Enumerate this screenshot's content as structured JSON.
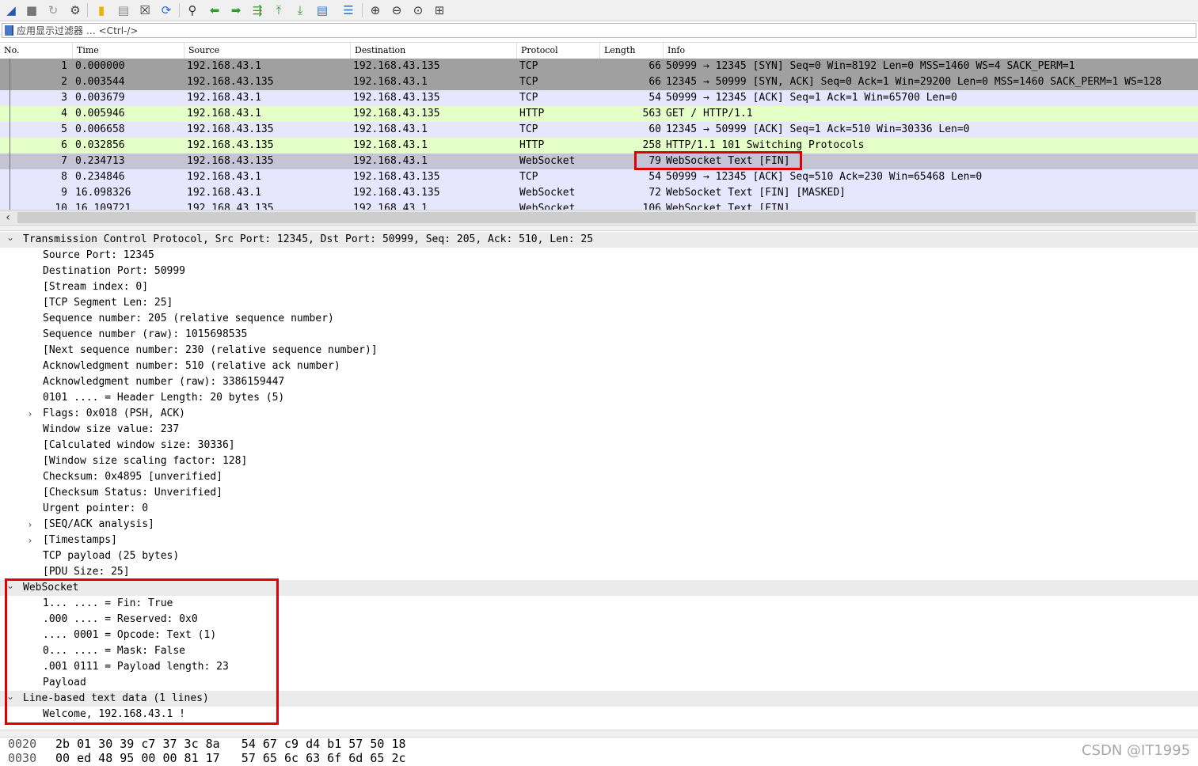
{
  "filter": {
    "placeholder": "应用显示过滤器 … <Ctrl-/>"
  },
  "columns": [
    "No.",
    "Time",
    "Source",
    "Destination",
    "Protocol",
    "Length",
    "Info"
  ],
  "colors": {
    "tcp_row": "#e7e6ff",
    "http_row": "#e4ffc7",
    "syn_row": "#a0a0a0",
    "selected_row": "#c4c4d6",
    "highlight_box": "#e00000"
  },
  "packets": [
    {
      "no": "1",
      "time": "0.000000",
      "src": "192.168.43.1",
      "dst": "192.168.43.135",
      "proto": "TCP",
      "len": "66",
      "info": "50999 → 12345 [SYN] Seq=0 Win=8192 Len=0 MSS=1460 WS=4 SACK_PERM=1",
      "style": "syn"
    },
    {
      "no": "2",
      "time": "0.003544",
      "src": "192.168.43.135",
      "dst": "192.168.43.1",
      "proto": "TCP",
      "len": "66",
      "info": "12345 → 50999 [SYN, ACK] Seq=0 Ack=1 Win=29200 Len=0 MSS=1460 SACK_PERM=1 WS=128",
      "style": "syn"
    },
    {
      "no": "3",
      "time": "0.003679",
      "src": "192.168.43.1",
      "dst": "192.168.43.135",
      "proto": "TCP",
      "len": "54",
      "info": "50999 → 12345 [ACK] Seq=1 Ack=1 Win=65700 Len=0",
      "style": "tcp"
    },
    {
      "no": "4",
      "time": "0.005946",
      "src": "192.168.43.1",
      "dst": "192.168.43.135",
      "proto": "HTTP",
      "len": "563",
      "info": "GET / HTTP/1.1",
      "style": "http"
    },
    {
      "no": "5",
      "time": "0.006658",
      "src": "192.168.43.135",
      "dst": "192.168.43.1",
      "proto": "TCP",
      "len": "60",
      "info": "12345 → 50999 [ACK] Seq=1 Ack=510 Win=30336 Len=0",
      "style": "tcp"
    },
    {
      "no": "6",
      "time": "0.032856",
      "src": "192.168.43.135",
      "dst": "192.168.43.1",
      "proto": "HTTP",
      "len": "258",
      "info": "HTTP/1.1 101 Switching Protocols",
      "style": "http"
    },
    {
      "no": "7",
      "time": "0.234713",
      "src": "192.168.43.135",
      "dst": "192.168.43.1",
      "proto": "WebSocket",
      "len": "79",
      "info": "WebSocket Text [FIN]",
      "style": "selected"
    },
    {
      "no": "8",
      "time": "0.234846",
      "src": "192.168.43.1",
      "dst": "192.168.43.135",
      "proto": "TCP",
      "len": "54",
      "info": "50999 → 12345 [ACK] Seq=510 Ack=230 Win=65468 Len=0",
      "style": "tcp"
    },
    {
      "no": "9",
      "time": "16.098326",
      "src": "192.168.43.1",
      "dst": "192.168.43.135",
      "proto": "WebSocket",
      "len": "72",
      "info": "WebSocket Text [FIN] [MASKED]",
      "style": "tcp"
    },
    {
      "no": "10",
      "time": "16.109721",
      "src": "192.168.43.135",
      "dst": "192.168.43.1",
      "proto": "WebSocket",
      "len": "106",
      "info": "WebSocket Text [FIN]",
      "style": "tcp"
    }
  ],
  "details": [
    {
      "text": "Transmission Control Protocol, Src Port: 12345, Dst Port: 50999, Seq: 205, Ack: 510, Len: 25",
      "level": 0,
      "arrow": "expanded",
      "section": true
    },
    {
      "text": "Source Port: 12345",
      "level": 1,
      "arrow": "none"
    },
    {
      "text": "Destination Port: 50999",
      "level": 1,
      "arrow": "none"
    },
    {
      "text": "[Stream index: 0]",
      "level": 1,
      "arrow": "none"
    },
    {
      "text": "[TCP Segment Len: 25]",
      "level": 1,
      "arrow": "none"
    },
    {
      "text": "Sequence number: 205    (relative sequence number)",
      "level": 1,
      "arrow": "none"
    },
    {
      "text": "Sequence number (raw): 1015698535",
      "level": 1,
      "arrow": "none"
    },
    {
      "text": "[Next sequence number: 230    (relative sequence number)]",
      "level": 1,
      "arrow": "none"
    },
    {
      "text": "Acknowledgment number: 510    (relative ack number)",
      "level": 1,
      "arrow": "none"
    },
    {
      "text": "Acknowledgment number (raw): 3386159447",
      "level": 1,
      "arrow": "none"
    },
    {
      "text": "0101 .... = Header Length: 20 bytes (5)",
      "level": 1,
      "arrow": "none"
    },
    {
      "text": "Flags: 0x018 (PSH, ACK)",
      "level": 1,
      "arrow": "collapsed"
    },
    {
      "text": "Window size value: 237",
      "level": 1,
      "arrow": "none"
    },
    {
      "text": "[Calculated window size: 30336]",
      "level": 1,
      "arrow": "none"
    },
    {
      "text": "[Window size scaling factor: 128]",
      "level": 1,
      "arrow": "none"
    },
    {
      "text": "Checksum: 0x4895 [unverified]",
      "level": 1,
      "arrow": "none"
    },
    {
      "text": "[Checksum Status: Unverified]",
      "level": 1,
      "arrow": "none"
    },
    {
      "text": "Urgent pointer: 0",
      "level": 1,
      "arrow": "none"
    },
    {
      "text": "[SEQ/ACK analysis]",
      "level": 1,
      "arrow": "collapsed"
    },
    {
      "text": "[Timestamps]",
      "level": 1,
      "arrow": "collapsed"
    },
    {
      "text": "TCP payload (25 bytes)",
      "level": 1,
      "arrow": "none"
    },
    {
      "text": "[PDU Size: 25]",
      "level": 1,
      "arrow": "none"
    },
    {
      "text": "WebSocket",
      "level": 0,
      "arrow": "expanded",
      "section": true
    },
    {
      "text": "1... .... = Fin: True",
      "level": 1,
      "arrow": "none"
    },
    {
      "text": ".000 .... = Reserved: 0x0",
      "level": 1,
      "arrow": "none"
    },
    {
      "text": ".... 0001 = Opcode: Text (1)",
      "level": 1,
      "arrow": "none"
    },
    {
      "text": "0... .... = Mask: False",
      "level": 1,
      "arrow": "none"
    },
    {
      "text": ".001 0111 = Payload length: 23",
      "level": 1,
      "arrow": "none"
    },
    {
      "text": "Payload",
      "level": 1,
      "arrow": "none"
    },
    {
      "text": "Line-based text data (1 lines)",
      "level": 0,
      "arrow": "expanded",
      "section": true
    },
    {
      "text": "Welcome, 192.168.43.1 !",
      "level": 1,
      "arrow": "none"
    }
  ],
  "bytes": [
    {
      "offset": "0020",
      "hex": "2b 01 30 39 c7 37 3c 8a   54 67 c9 d4 b1 57 50 18"
    },
    {
      "offset": "0030",
      "hex": "00 ed 48 95 00 00 81 17   57 65 6c 63 6f 6d 65 2c"
    }
  ],
  "watermark": "CSDN @IT1995"
}
